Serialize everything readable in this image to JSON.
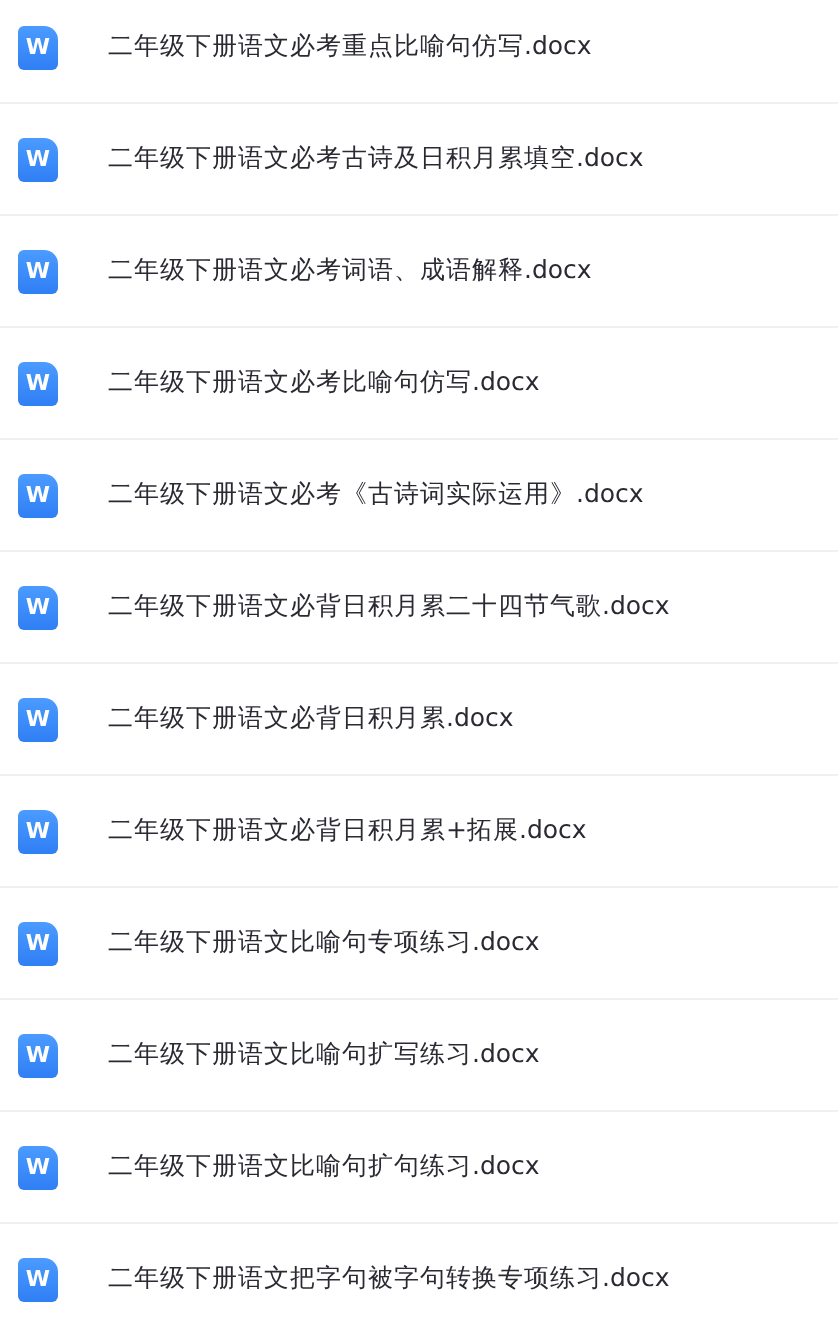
{
  "files": [
    {
      "name": "二年级下册语文必考重点比喻句仿写.docx",
      "icon_letter": "W"
    },
    {
      "name": "二年级下册语文必考古诗及日积月累填空.docx",
      "icon_letter": "W"
    },
    {
      "name": "二年级下册语文必考词语、成语解释.docx",
      "icon_letter": "W"
    },
    {
      "name": "二年级下册语文必考比喻句仿写.docx",
      "icon_letter": "W"
    },
    {
      "name": "二年级下册语文必考《古诗词实际运用》.docx",
      "icon_letter": "W"
    },
    {
      "name": "二年级下册语文必背日积月累二十四节气歌.docx",
      "icon_letter": "W"
    },
    {
      "name": "二年级下册语文必背日积月累.docx",
      "icon_letter": "W"
    },
    {
      "name": "二年级下册语文必背日积月累+拓展.docx",
      "icon_letter": "W"
    },
    {
      "name": "二年级下册语文比喻句专项练习.docx",
      "icon_letter": "W"
    },
    {
      "name": "二年级下册语文比喻句扩写练习.docx",
      "icon_letter": "W"
    },
    {
      "name": "二年级下册语文比喻句扩句练习.docx",
      "icon_letter": "W"
    },
    {
      "name": "二年级下册语文把字句被字句转换专项练习.docx",
      "icon_letter": "W"
    }
  ]
}
